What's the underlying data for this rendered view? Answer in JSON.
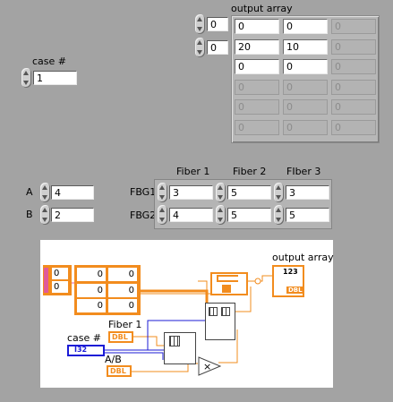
{
  "output_array": {
    "label": "output array",
    "index_row": "0",
    "index_col": "0",
    "rows": [
      [
        "0",
        "0",
        "0"
      ],
      [
        "20",
        "10",
        "0"
      ],
      [
        "0",
        "0",
        "0"
      ],
      [
        "0",
        "0",
        "0"
      ],
      [
        "0",
        "0",
        "0"
      ],
      [
        "0",
        "0",
        "0"
      ]
    ]
  },
  "case_control": {
    "label": "case #",
    "value": "1"
  },
  "ab_controls": {
    "a": {
      "label": "A",
      "value": "4"
    },
    "b": {
      "label": "B",
      "value": "2"
    }
  },
  "fiber_array": {
    "col_headers": [
      "Fiber 1",
      "Fiber 2",
      "FIber 3"
    ],
    "row_labels": [
      "FBG1",
      "FBG2"
    ],
    "rows": [
      [
        "3",
        "5",
        "3"
      ],
      [
        "4",
        "5",
        "5"
      ]
    ]
  },
  "diagram": {
    "const_index": [
      "0",
      "0"
    ],
    "const_values": [
      [
        "0",
        "0"
      ],
      [
        "0",
        "0"
      ],
      [
        "0",
        "0"
      ]
    ],
    "output_label": "output array",
    "output_type_top": "123",
    "output_type_bottom": "DBL",
    "fiber1_label": "Fiber 1",
    "fiber1_type": "DBL",
    "case_label": "case #",
    "case_type": "I32",
    "ab_label": "A/B",
    "ab_type": "DBL"
  },
  "colors": {
    "panel_bg": "#a3a3a3",
    "wire_orange": "#f28c1e",
    "wire_blue": "#1b1bd6",
    "wire_pink": "#e05a9a"
  }
}
